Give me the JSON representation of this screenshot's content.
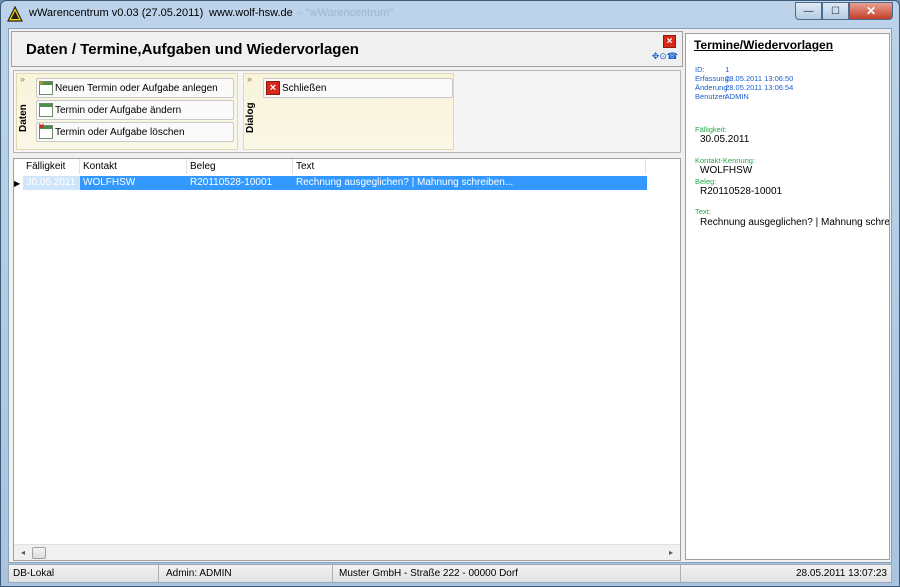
{
  "window": {
    "title": "wWarencentrum v0.03 (27.05.2011)",
    "url": "www.wolf-hsw.de",
    "ghost_text": "- \"wWarencentrum\"",
    "minimize_glyph": "—",
    "maximize_glyph": "☐",
    "close_glyph": "✕"
  },
  "header": {
    "title": "Daten / Termine,Aufgaben und Wiedervorlagen",
    "close_glyph": "×",
    "tool_icons": "✥⊙☎"
  },
  "ribbon": {
    "groups": [
      {
        "label": "Daten",
        "buttons": [
          {
            "label": "Neuen Termin oder Aufgabe anlegen",
            "icon": "calendar-new-icon"
          },
          {
            "label": "Termin oder Aufgabe ändern",
            "icon": "calendar-edit-icon"
          },
          {
            "label": "Termin oder Aufgabe löschen",
            "icon": "calendar-delete-icon"
          }
        ]
      },
      {
        "label": "Dialog",
        "buttons": [
          {
            "label": "Schließen",
            "icon": "close-red-icon"
          }
        ]
      }
    ],
    "collapse_glyph": "»"
  },
  "grid": {
    "columns": [
      "Fälligkeit",
      "Kontakt",
      "Beleg",
      "Text"
    ],
    "rows": [
      {
        "faelligkeit": "30.05.2011",
        "kontakt": "WOLFHSW",
        "beleg": "R20110528-10001",
        "text": "Rechnung ausgeglichen? | Mahnung schreiben..."
      }
    ],
    "row_indicator": "▶",
    "scroll_left": "◂",
    "scroll_right": "▸"
  },
  "detail": {
    "title": "Termine/Wiedervorlagen",
    "meta": [
      {
        "key": "ID:",
        "value": "1"
      },
      {
        "key": "Erfassung:",
        "value": "28.05.2011 13:06:50"
      },
      {
        "key": "Änderung:",
        "value": "28.05.2011 13:06:54"
      },
      {
        "key": "Benutzer:",
        "value": "ADMIN"
      }
    ],
    "fields": [
      {
        "label": "Fälligkeit:",
        "value": "30.05.2011"
      },
      {
        "label": "Kontakt-Kennung:",
        "value": "WOLFHSW"
      },
      {
        "label": "Beleg:",
        "value": "R20110528-10001"
      },
      {
        "label": "Text:",
        "value": "Rechnung ausgeglichen? | Mahnung schreiben..."
      }
    ]
  },
  "statusbar": {
    "db": "DB-Lokal",
    "user": "Admin: ADMIN",
    "company": "Muster GmbH  -  Straße 222  -  00000 Dorf",
    "datetime": "28.05.2011 13:07:23"
  },
  "colors": {
    "selection": "#3399ff",
    "meta_text": "#1a5fd0",
    "field_label": "#2aa84a",
    "ribbon_group": "#f8f4dc"
  }
}
